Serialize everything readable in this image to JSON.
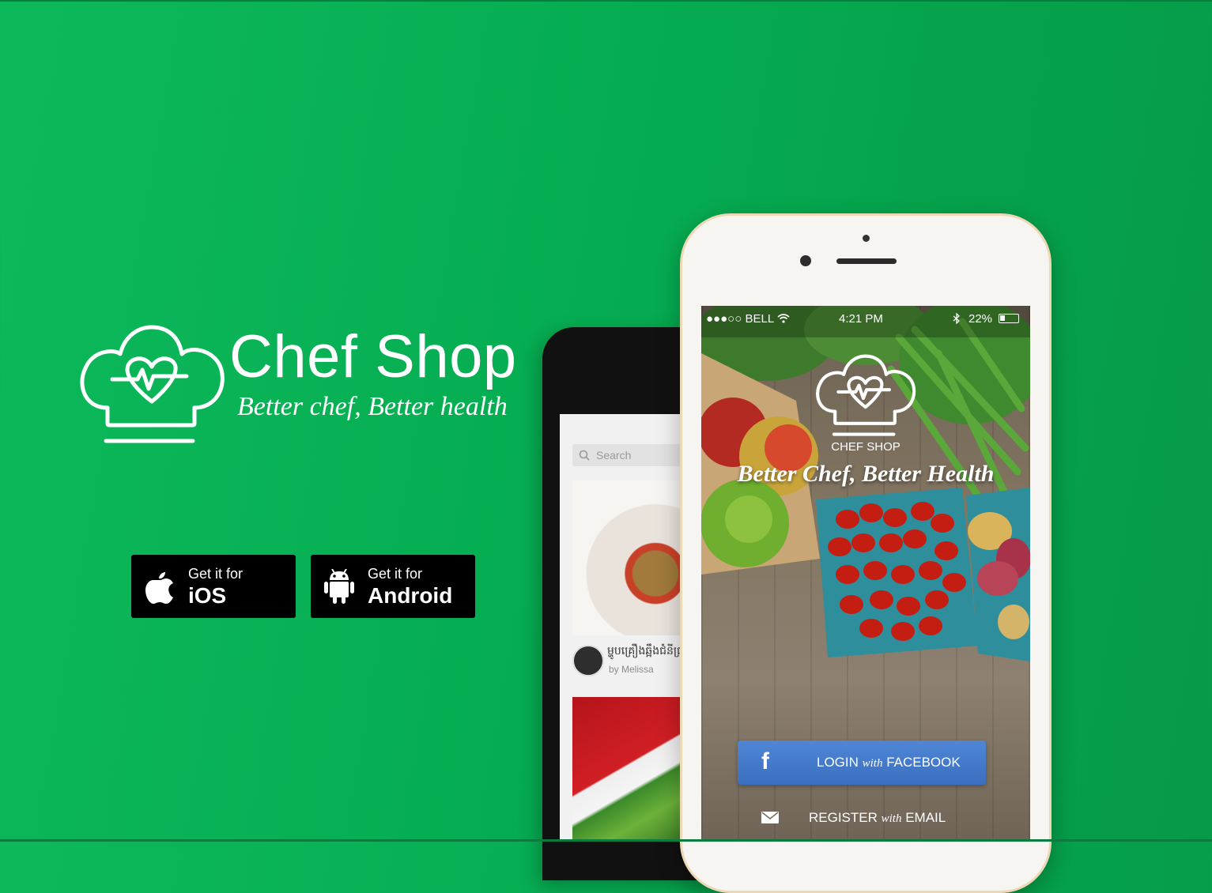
{
  "brand": {
    "name": "Chef Shop",
    "tagline": "Better chef, Better health"
  },
  "store_buttons": [
    {
      "small": "Get it for",
      "big": "iOS",
      "icon": "apple-icon"
    },
    {
      "small": "Get it for",
      "big": "Android",
      "icon": "android-icon"
    }
  ],
  "back_phone": {
    "search_placeholder": "Search",
    "card_title": "ម្ហូបគ្រឿងឆ្អឹងជំនីជ្រូក",
    "card_author": "by Melissa"
  },
  "front_phone": {
    "status": {
      "carrier": "●●●○○ BELL",
      "time": "4:21 PM",
      "battery": "22%"
    },
    "app_name": "CHEF SHOP",
    "app_tagline": "Better Chef, Better Health",
    "facebook_button": {
      "pre": "LOGIN ",
      "with": "with",
      "post": " FACEBOOK"
    },
    "email_button": {
      "pre": "REGISTER ",
      "with": "with",
      "post": " EMAIL"
    }
  },
  "colors": {
    "background": "#06ad52",
    "facebook": "#3b6fc0",
    "phone_frame": "#f6f5f1"
  }
}
